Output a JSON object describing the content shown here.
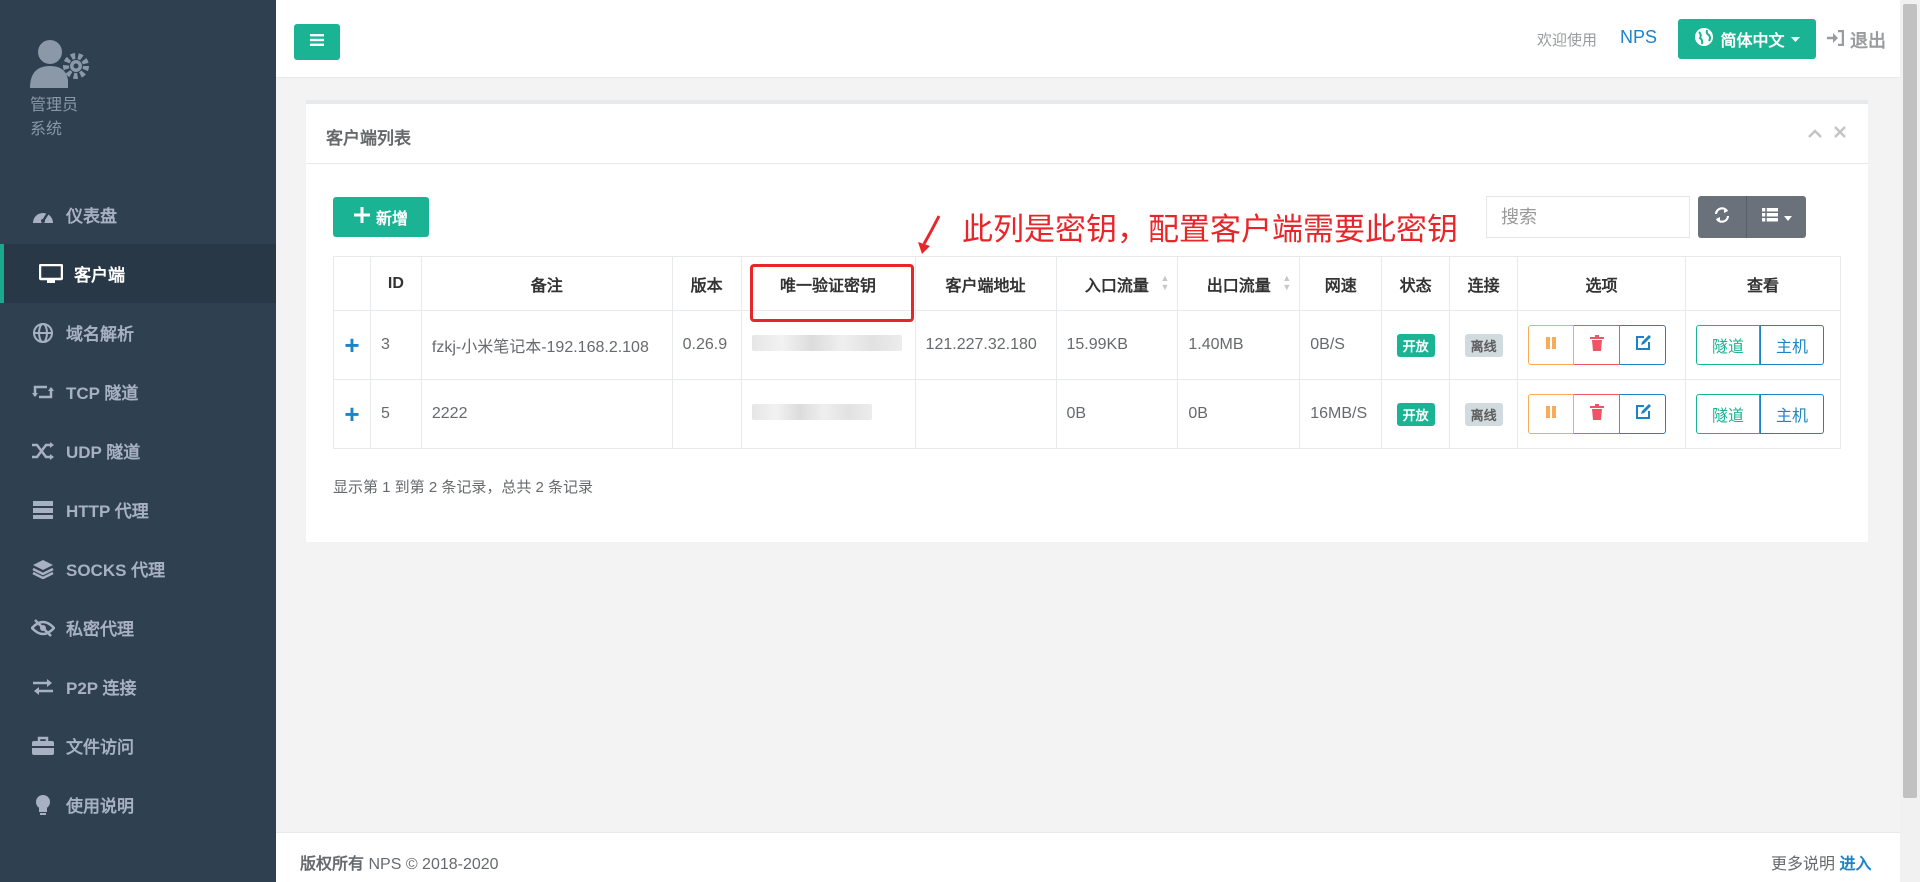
{
  "sidebar": {
    "profile": {
      "name": "管理员",
      "role": "系统"
    },
    "items": [
      {
        "label": "仪表盘",
        "icon": "dashboard-icon",
        "active": false
      },
      {
        "label": "客户端",
        "icon": "desktop-icon",
        "active": true
      },
      {
        "label": "域名解析",
        "icon": "globe-icon",
        "active": false
      },
      {
        "label": "TCP 隧道",
        "icon": "retweet-icon",
        "active": false
      },
      {
        "label": "UDP 隧道",
        "icon": "random-icon",
        "active": false
      },
      {
        "label": "HTTP 代理",
        "icon": "server-icon",
        "active": false
      },
      {
        "label": "SOCKS 代理",
        "icon": "layers-icon",
        "active": false
      },
      {
        "label": "私密代理",
        "icon": "eye-slash-icon",
        "active": false
      },
      {
        "label": "P2P 连接",
        "icon": "exchange-icon",
        "active": false
      },
      {
        "label": "文件访问",
        "icon": "briefcase-icon",
        "active": false
      },
      {
        "label": "使用说明",
        "icon": "lightbulb-icon",
        "active": false
      }
    ]
  },
  "topbar": {
    "welcome": "欢迎使用",
    "brand": "NPS",
    "language": "简体中文",
    "logout": "退出"
  },
  "panel": {
    "title": "客户端列表",
    "add_label": "新增",
    "search_placeholder": "搜索",
    "pager_info": "显示第 1 到第 2 条记录，总共 2 条记录"
  },
  "table": {
    "headers": [
      "ID",
      "备注",
      "版本",
      "唯一验证密钥",
      "客户端地址",
      "入口流量",
      "出口流量",
      "网速",
      "状态",
      "连接",
      "选项",
      "查看"
    ],
    "rows": [
      {
        "id": "3",
        "remark": "fzkj-小米笔记本-192.168.2.108",
        "version": "0.26.9",
        "address": "121.227.32.180",
        "in_flow": "15.99KB",
        "out_flow": "1.40MB",
        "speed": "0B/S",
        "status": "开放",
        "connection": "离线"
      },
      {
        "id": "5",
        "remark": "2222",
        "version": "",
        "address": "",
        "in_flow": "0B",
        "out_flow": "0B",
        "speed": "16MB/S",
        "status": "开放",
        "connection": "离线"
      }
    ],
    "view_tunnel": "隧道",
    "view_host": "主机"
  },
  "annotation": {
    "text": "此列是密钥，配置客户端需要此密钥",
    "color": "#e8262a"
  },
  "footer": {
    "copyright_prefix": "版权所有",
    "copyright_text": "NPS © 2018-2020",
    "more_label": "更多说明",
    "more_link": "进入"
  },
  "colors": {
    "sidebar_bg": "#2f4050",
    "primary": "#1ab394",
    "link": "#1c84c6",
    "warning": "#f8ac59",
    "danger": "#ed5565"
  }
}
